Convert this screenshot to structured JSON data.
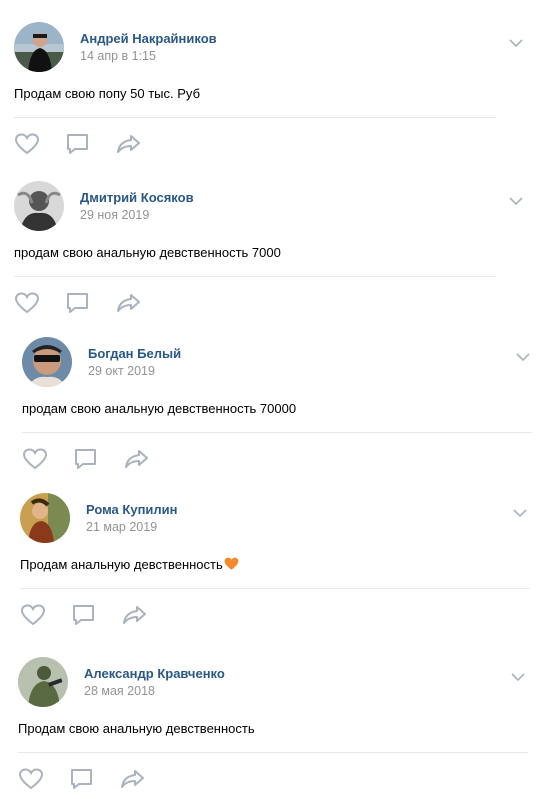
{
  "posts": [
    {
      "author": "Андрей Накрайников",
      "date": "14 апр в 1:15",
      "text": "Продам свою попу 50 тыс. Руб",
      "avatar_icon": "user-photo",
      "has_emoji": false
    },
    {
      "author": "Дмитрий Косяков",
      "date": "29 ноя 2019",
      "text": "продам свою анальную девственность 7000",
      "avatar_icon": "user-photo",
      "has_emoji": false
    },
    {
      "author": "Богдан Белый",
      "date": "29 окт 2019",
      "text": "продам свою анальную девственность 70000",
      "avatar_icon": "user-photo",
      "has_emoji": false
    },
    {
      "author": "Рома Купилин",
      "date": "21 мар 2019",
      "text": "Продам анальную девственность",
      "avatar_icon": "user-photo",
      "has_emoji": true,
      "emoji": "orange-heart"
    },
    {
      "author": "Александр Кравченко",
      "date": "28 мая 2018",
      "text": "Продам свою анальную девственность",
      "avatar_icon": "user-photo",
      "has_emoji": false
    }
  ],
  "icons": {
    "like": "heart-icon",
    "comment": "comment-icon",
    "share": "share-arrow-icon",
    "menu": "chevron-down-icon"
  },
  "colors": {
    "author_link": "#2a5885",
    "date_gray": "#939393",
    "icon_gray": "#aab2bd",
    "divider": "#e7e8ec",
    "emoji_heart": "#f4892a"
  }
}
